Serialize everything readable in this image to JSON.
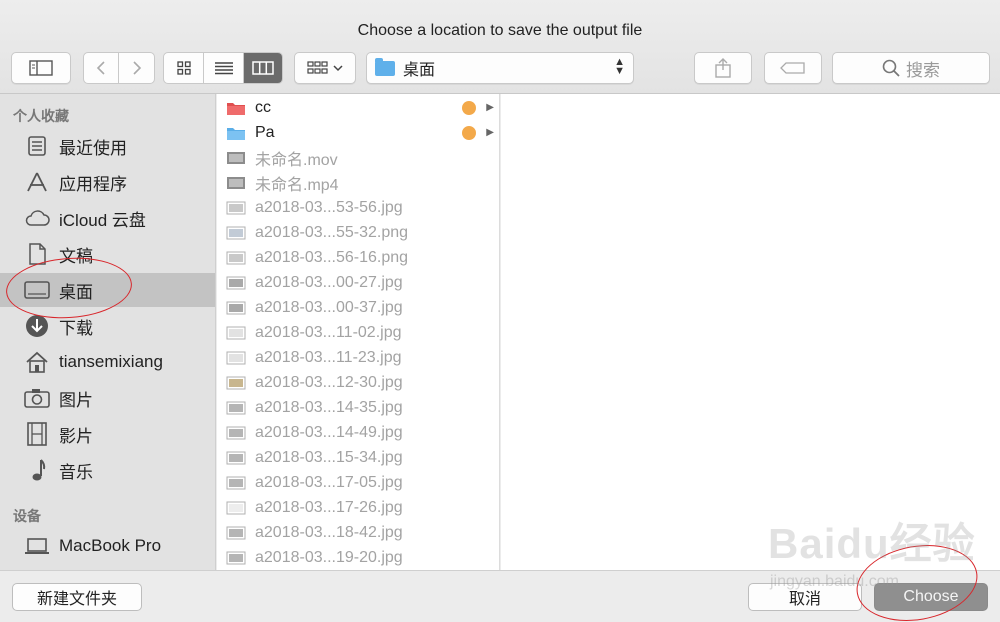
{
  "window": {
    "title": "Choose a location to save the output file"
  },
  "toolbar": {
    "path_label": "桌面",
    "search_placeholder": "搜索",
    "icons": {
      "sidebar_toggle": "sidebar-toggle-icon",
      "back": "chevron-left-icon",
      "forward": "chevron-right-icon",
      "view_icons": "grid-view-icon",
      "view_list": "list-view-icon",
      "view_columns": "column-view-icon",
      "arrange": "arrange-icon",
      "share": "share-icon",
      "tags": "tag-icon",
      "search": "magnifier-icon"
    }
  },
  "sidebar": {
    "favorites_header": "个人收藏",
    "devices_header": "设备",
    "favorites": [
      {
        "label": "最近使用",
        "icon": "recents-icon"
      },
      {
        "label": "应用程序",
        "icon": "applications-icon"
      },
      {
        "label": "iCloud 云盘",
        "icon": "cloud-icon"
      },
      {
        "label": "文稿",
        "icon": "documents-icon"
      },
      {
        "label": "桌面",
        "icon": "desktop-icon",
        "selected": true
      },
      {
        "label": "下载",
        "icon": "downloads-icon"
      },
      {
        "label": "tiansemixiang",
        "icon": "home-icon"
      },
      {
        "label": "图片",
        "icon": "camera-icon"
      },
      {
        "label": "影片",
        "icon": "film-icon"
      },
      {
        "label": "音乐",
        "icon": "music-icon"
      }
    ],
    "devices": [
      {
        "label": "MacBook Pro",
        "icon": "laptop-icon"
      }
    ]
  },
  "files": [
    {
      "name": "cc",
      "kind": "folder-red",
      "dim": false,
      "tag": "#f3a94a"
    },
    {
      "name": "Pa",
      "kind": "folder-blue",
      "dim": false,
      "tag": "#f3a94a"
    },
    {
      "name": "未命名.mov",
      "kind": "video",
      "dim": true
    },
    {
      "name": "未命名.mp4",
      "kind": "video",
      "dim": true
    },
    {
      "name": "a2018-03...53-56.jpg",
      "kind": "image",
      "dim": true
    },
    {
      "name": "a2018-03...55-32.png",
      "kind": "image",
      "dim": true
    },
    {
      "name": "a2018-03...56-16.png",
      "kind": "image",
      "dim": true
    },
    {
      "name": "a2018-03...00-27.jpg",
      "kind": "image",
      "dim": true
    },
    {
      "name": "a2018-03...00-37.jpg",
      "kind": "image",
      "dim": true
    },
    {
      "name": "a2018-03...11-02.jpg",
      "kind": "image",
      "dim": true
    },
    {
      "name": "a2018-03...11-23.jpg",
      "kind": "image",
      "dim": true
    },
    {
      "name": "a2018-03...12-30.jpg",
      "kind": "image",
      "dim": true
    },
    {
      "name": "a2018-03...14-35.jpg",
      "kind": "image",
      "dim": true
    },
    {
      "name": "a2018-03...14-49.jpg",
      "kind": "image",
      "dim": true
    },
    {
      "name": "a2018-03...15-34.jpg",
      "kind": "image",
      "dim": true
    },
    {
      "name": "a2018-03...17-05.jpg",
      "kind": "image",
      "dim": true
    },
    {
      "name": "a2018-03...17-26.jpg",
      "kind": "image",
      "dim": true
    },
    {
      "name": "a2018-03...18-42.jpg",
      "kind": "image",
      "dim": true
    },
    {
      "name": "a2018-03...19-20.jpg",
      "kind": "image",
      "dim": true
    }
  ],
  "footer": {
    "new_folder": "新建文件夹",
    "cancel": "取消",
    "choose": "Choose"
  },
  "watermark": {
    "main": "Baidu经验",
    "sub": "jingyan.baidu.com"
  },
  "colors": {
    "annotation": "#d8262b",
    "tag_orange": "#f3a94a",
    "selected_row": "#c3c3c3"
  }
}
